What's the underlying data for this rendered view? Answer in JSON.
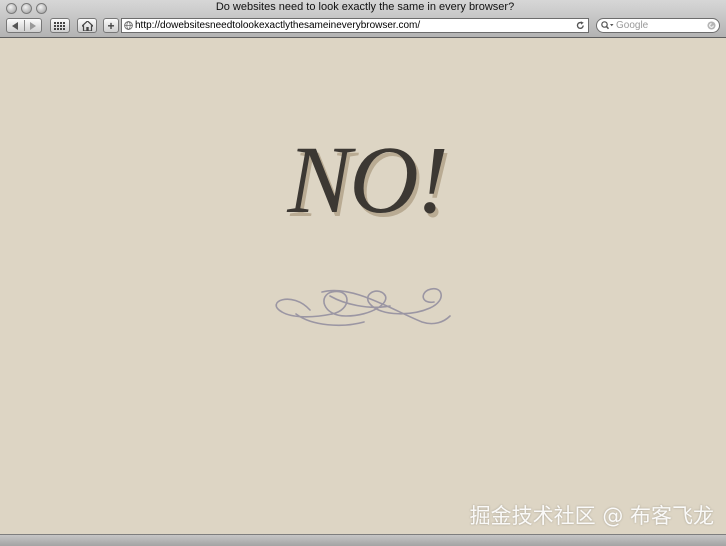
{
  "window": {
    "title": "Do websites need to look exactly the same in every browser?"
  },
  "toolbar": {
    "back_icon": "back-arrow-icon",
    "forward_icon": "forward-arrow-icon",
    "bookmarks_icon": "grid-icon",
    "home_icon": "home-icon",
    "add_label": "+",
    "url": "http://dowebsitesneedtolookexactlythesameineverybrowser.com/",
    "reload_icon": "reload-icon",
    "search_placeholder": "Google"
  },
  "content": {
    "headline": "NO!",
    "ornament": "flourish"
  },
  "watermark": {
    "text": "掘金技术社区 @ 布客飞龙"
  },
  "colors": {
    "page_bg": "#ddd5c4",
    "headline": "#3c3833",
    "headline_shadow": "#b9ab93",
    "flourish": "#9b96a3"
  }
}
